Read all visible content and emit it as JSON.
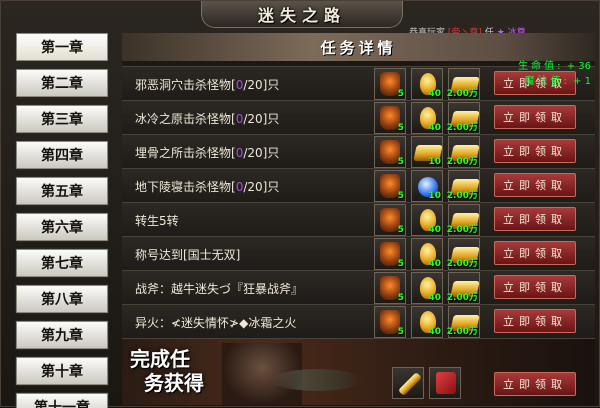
{
  "title": "迷失之路",
  "announcement": {
    "prefix": "恭喜玩家",
    "player": "[帝丶尊]",
    "middle": "任",
    "icon": "★",
    "title_text": "冰尊"
  },
  "panel_title": "任务详情",
  "stats": {
    "hp_label": "生命值:",
    "hp_value": "+ 36",
    "mp_label": "魔法值:",
    "mp_value": "+ 1"
  },
  "chapters": [
    "第一章",
    "第二章",
    "第三章",
    "第四章",
    "第五章",
    "第六章",
    "第七章",
    "第八章",
    "第九章",
    "第十章",
    "第十一章"
  ],
  "claim_label": "立即领取",
  "tasks": [
    {
      "text": "邪恶洞穴击杀怪物",
      "progress": "0",
      "total": "/20]只",
      "rewards": [
        {
          "icon": "armor-icon",
          "qty": "5"
        },
        {
          "icon": "gold-ingot-icon",
          "qty": "40"
        },
        {
          "icon": "gold-pile-icon",
          "qty": "2.00万"
        }
      ]
    },
    {
      "text": "冰冷之原击杀怪物",
      "progress": "0",
      "total": "/20]只",
      "rewards": [
        {
          "icon": "armor-icon",
          "qty": "5"
        },
        {
          "icon": "gold-ingot-icon",
          "qty": "40"
        },
        {
          "icon": "gold-pile-icon",
          "qty": "2.00万"
        }
      ]
    },
    {
      "text": "埋骨之所击杀怪物",
      "progress": "0",
      "total": "/20]只",
      "rewards": [
        {
          "icon": "armor-icon",
          "qty": "5"
        },
        {
          "icon": "gold-bar-icon",
          "qty": "10"
        },
        {
          "icon": "gold-pile-icon",
          "qty": "2.00万"
        }
      ]
    },
    {
      "text": "地下陵寝击杀怪物",
      "progress": "0",
      "total": "/20]只",
      "rewards": [
        {
          "icon": "armor-icon",
          "qty": "5"
        },
        {
          "icon": "blue-gem-icon",
          "qty": "10"
        },
        {
          "icon": "gold-pile-icon",
          "qty": "2.00万"
        }
      ]
    },
    {
      "text": "转生5转",
      "progress": "",
      "total": "",
      "rewards": [
        {
          "icon": "armor-icon",
          "qty": "5"
        },
        {
          "icon": "gold-ingot-icon",
          "qty": "40"
        },
        {
          "icon": "gold-pile-icon",
          "qty": "2.00万"
        }
      ]
    },
    {
      "text": "称号达到[国士无双]",
      "progress": "",
      "total": "",
      "rewards": [
        {
          "icon": "armor-icon",
          "qty": "5"
        },
        {
          "icon": "gold-ingot-icon",
          "qty": "40"
        },
        {
          "icon": "gold-pile-icon",
          "qty": "2.00万"
        }
      ]
    },
    {
      "text": "战斧：越牛迷失づ『狂暴战斧』",
      "progress": "",
      "total": "",
      "rewards": [
        {
          "icon": "armor-icon",
          "qty": "5"
        },
        {
          "icon": "gold-ingot-icon",
          "qty": "40"
        },
        {
          "icon": "gold-pile-icon",
          "qty": "2.00万"
        }
      ]
    },
    {
      "text": "异火：≮迷失情怀≯◆冰霜之火",
      "progress": "",
      "total": "",
      "rewards": [
        {
          "icon": "armor-icon",
          "qty": "5"
        },
        {
          "icon": "gold-ingot-icon",
          "qty": "40"
        },
        {
          "icon": "gold-pile-icon",
          "qty": "2.00万"
        }
      ]
    }
  ],
  "banner": {
    "line1": "完成任",
    "line2": "务获得",
    "rewards": [
      {
        "icon": "golden-sword-icon",
        "qty": ""
      },
      {
        "icon": "red-scroll-icon",
        "qty": ""
      }
    ]
  }
}
